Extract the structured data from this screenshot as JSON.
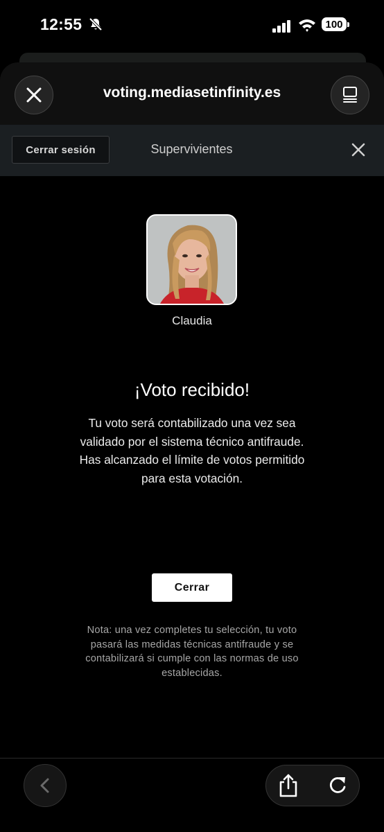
{
  "status_bar": {
    "time": "12:55",
    "battery": "100",
    "icons": [
      "bell-slash-icon",
      "signal-icon",
      "wifi-icon",
      "battery-icon"
    ]
  },
  "browser": {
    "url": "voting.mediasetinfinity.es",
    "icons": [
      "close-icon",
      "tabs-icon",
      "back-icon",
      "share-icon",
      "reload-icon"
    ]
  },
  "site_header": {
    "logout_label": "Cerrar sesión",
    "title": "Supervivientes",
    "icon": "close-icon"
  },
  "vote": {
    "person_name": "Claudia",
    "title": "¡Voto recibido!",
    "message_lines": [
      "Tu voto será contabilizado una vez sea",
      "validado por el sistema técnico antifraude.",
      "Has alcanzado el límite de votos permitido",
      "para esta votación."
    ],
    "close_label": "Cerrar",
    "note_lines": [
      "Nota: una vez completes tu selección, tu voto",
      "pasará las medidas técnicas antifraude y se",
      "contabilizará si cumple con las normas de uso",
      "establecidas."
    ]
  },
  "colors": {
    "background": "#000000",
    "site_bar": "#1b1f22",
    "button_primary": "#ffffff",
    "note_text": "#a7a7a7"
  }
}
